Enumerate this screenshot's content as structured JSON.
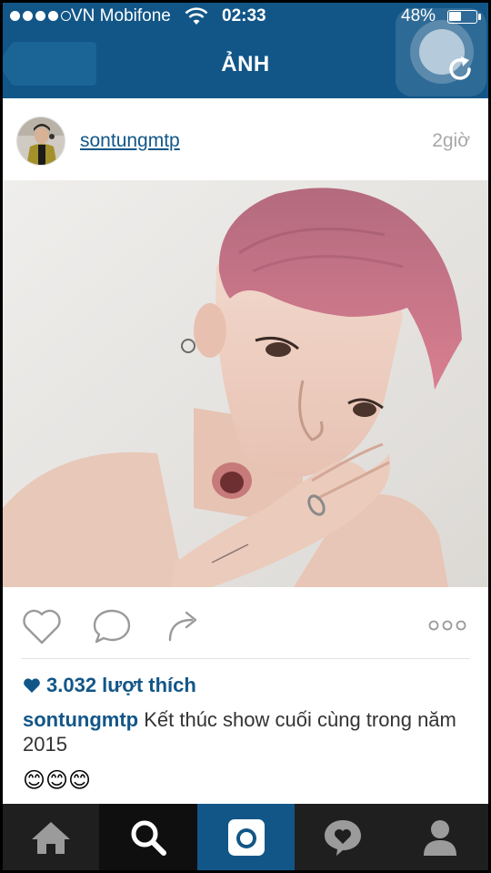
{
  "status_bar": {
    "carrier": "VN Mobifone",
    "time": "02:33",
    "battery_percent_label": "48%",
    "battery_level": 0.48,
    "signal_bars": 4
  },
  "nav": {
    "title": "ẢNH",
    "back_icon": "chevron-left-icon",
    "refresh_icon": "refresh-icon"
  },
  "post": {
    "username": "sontungmtp",
    "time_ago": "2giờ",
    "likes_label": "3.032 lượt thích",
    "caption_username": "sontungmtp",
    "caption_text": "Kết thúc show cuối cùng trong năm 2015",
    "emojis": "😊😊😊"
  },
  "actions": {
    "like_icon": "heart-icon",
    "comment_icon": "comment-icon",
    "share_icon": "share-icon",
    "more_icon": "more-icon"
  },
  "tabbar": {
    "tabs": [
      "home",
      "search",
      "camera",
      "activity",
      "profile"
    ],
    "active": "search"
  },
  "colors": {
    "brand": "#125688",
    "tabbar": "#1f1f1f",
    "time_gray": "#a8a8a8"
  }
}
